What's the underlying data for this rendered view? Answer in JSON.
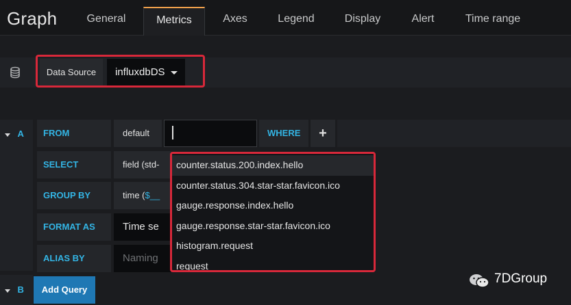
{
  "header": {
    "title": "Graph",
    "tabs": [
      {
        "label": "General"
      },
      {
        "label": "Metrics",
        "active": true
      },
      {
        "label": "Axes"
      },
      {
        "label": "Legend"
      },
      {
        "label": "Display"
      },
      {
        "label": "Alert"
      },
      {
        "label": "Time range"
      }
    ]
  },
  "datasource": {
    "label": "Data Source",
    "value": "influxdbDS"
  },
  "query_a": {
    "letter": "A",
    "from": {
      "label": "FROM",
      "policy": "default",
      "measurement_value": "",
      "where_label": "WHERE",
      "add": "+"
    },
    "select": {
      "label": "SELECT",
      "value": "field (std-"
    },
    "group_by": {
      "label": "GROUP BY",
      "prefix": "time (",
      "value": "$__"
    },
    "format_as": {
      "label": "FORMAT AS",
      "value": "Time se"
    },
    "alias_by": {
      "label": "ALIAS BY",
      "placeholder": "Naming"
    }
  },
  "query_b": {
    "letter": "B"
  },
  "add_query_label": "Add Query",
  "measurement_dropdown": {
    "options": [
      "counter.status.200.index.hello",
      "counter.status.304.star-star.favicon.ico",
      "gauge.response.index.hello",
      "gauge.response.star-star.favicon.ico",
      "histogram.request",
      "request"
    ],
    "highlighted_index": 0
  },
  "watermark": {
    "text": "7DGroup"
  },
  "colors": {
    "accent_blue": "#33b5e5",
    "active_tab_border": "#f0a04b",
    "highlight_red": "#d8283a",
    "button_blue": "#1f78b4"
  }
}
